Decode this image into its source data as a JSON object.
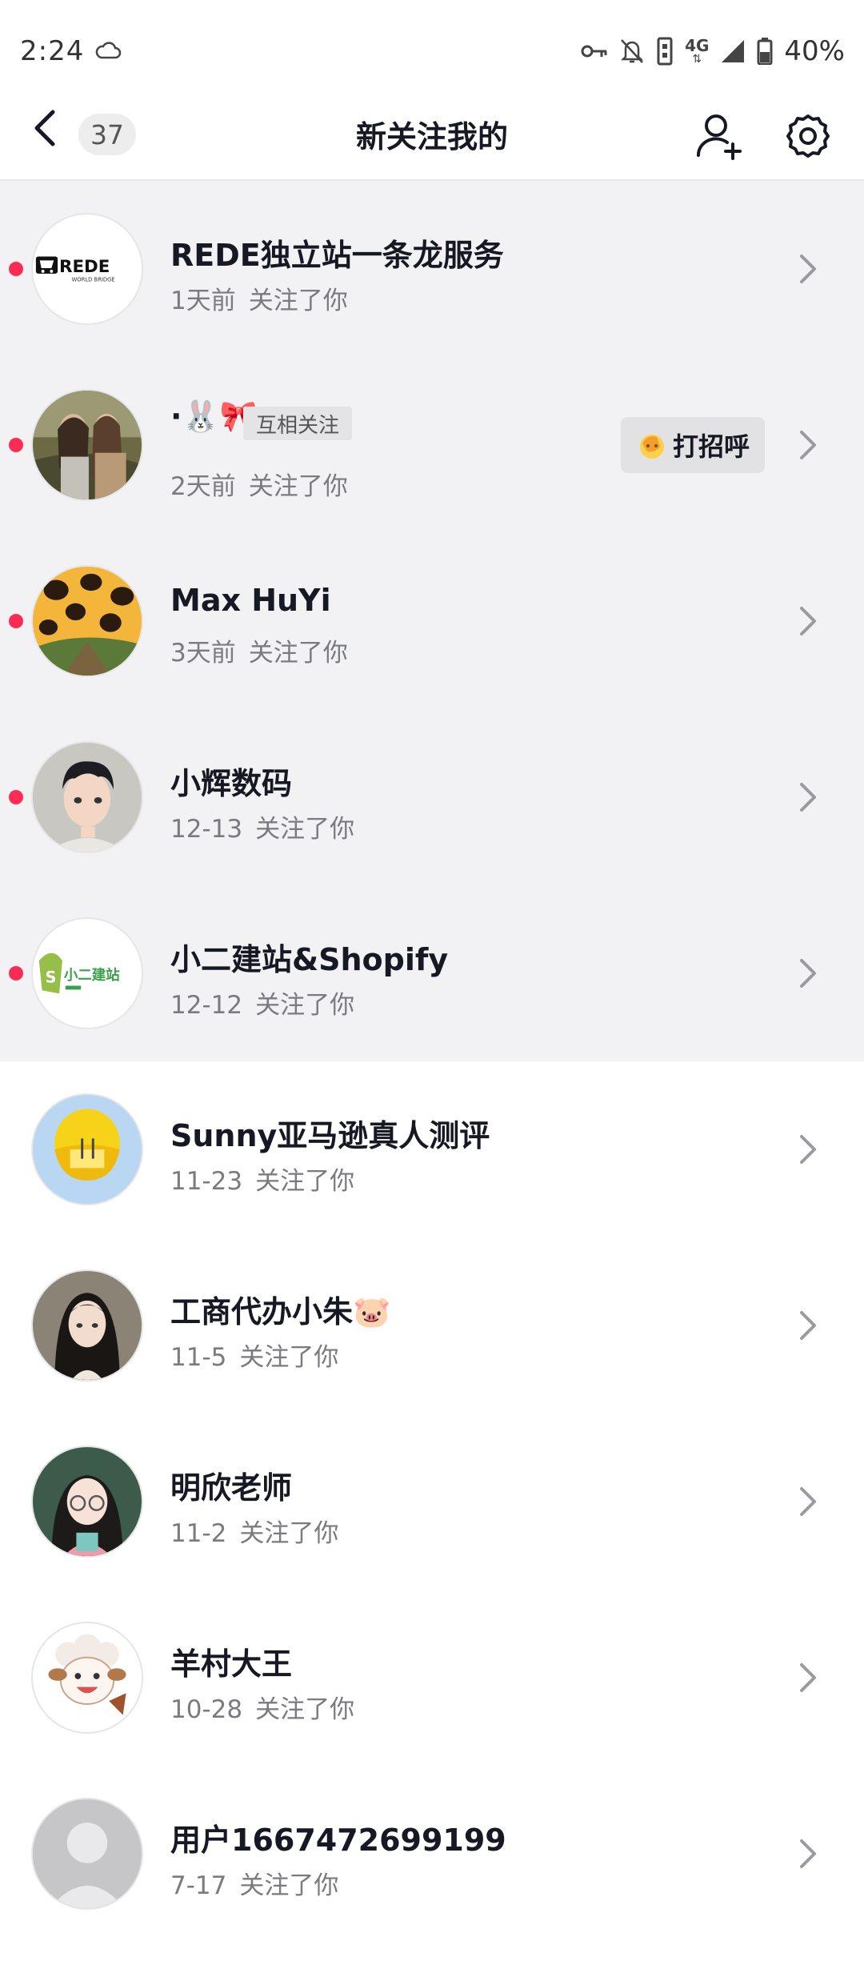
{
  "status_bar": {
    "time": "2:24",
    "battery": "40%",
    "network": "4G",
    "icons": [
      "cloud-icon",
      "key-icon",
      "bell-off-icon",
      "vibrate-icon",
      "signal-icon",
      "battery-icon"
    ]
  },
  "nav": {
    "count": "37",
    "title": "新关注我的",
    "icons": [
      "back-arrow-icon",
      "add-user-icon",
      "gear-icon"
    ]
  },
  "followers": [
    {
      "name": "REDE独立站一条龙服务",
      "time": "1天前",
      "action": "关注了你",
      "unread": true
    },
    {
      "name": "·🐰🎀",
      "tag": "互相关注",
      "time": "2天前",
      "action": "关注了你",
      "unread": true,
      "button": "打招呼"
    },
    {
      "name": "Max HuYi",
      "time": "3天前",
      "action": "关注了你",
      "unread": true
    },
    {
      "name": "小辉数码",
      "time": "12-13",
      "action": "关注了你",
      "unread": true
    },
    {
      "name": "小二建站&Shopify",
      "time": "12-12",
      "action": "关注了你",
      "unread": true
    },
    {
      "name": "Sunny亚马逊真人测评",
      "time": "11-23",
      "action": "关注了你",
      "unread": false
    },
    {
      "name": "工商代办小朱🐷",
      "time": "11-5",
      "action": "关注了你",
      "unread": false
    },
    {
      "name": "明欣老师",
      "time": "11-2",
      "action": "关注了你",
      "unread": false
    },
    {
      "name": "羊村大王",
      "time": "10-28",
      "action": "关注了你",
      "unread": false
    },
    {
      "name": "用户1667472699199",
      "time": "7-17",
      "action": "关注了你",
      "unread": false
    }
  ],
  "avatar_logos": {
    "rede_brand": "REDE",
    "rede_sub": "WORLD BRIDGE",
    "xiaoer_brand": "小二建站"
  },
  "colors": {
    "unread_dot": "#fe2c55",
    "unread_bg": "#f2f2f4",
    "text_primary": "#161823",
    "text_secondary": "#7a7b80"
  }
}
